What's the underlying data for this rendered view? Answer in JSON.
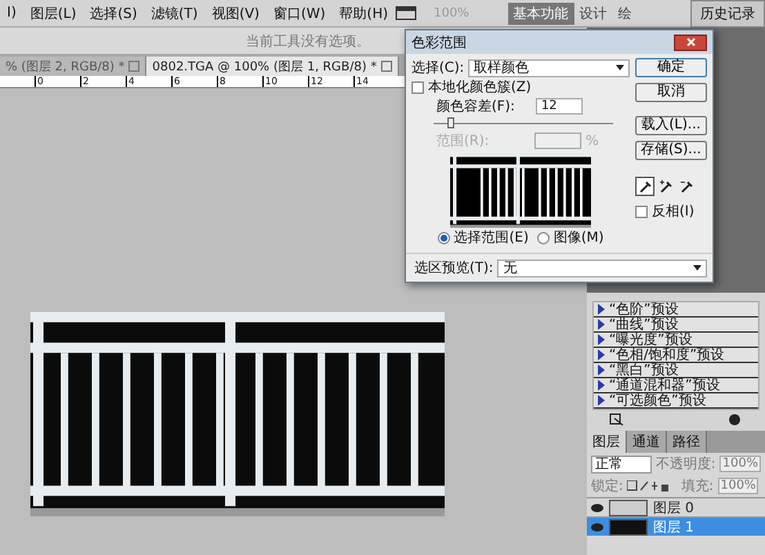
{
  "menu_bar": {
    "items": [
      {
        "label": "I)"
      },
      {
        "label": "图层(L)"
      },
      {
        "label": "选择(S)"
      },
      {
        "label": "滤镜(T)"
      },
      {
        "label": "视图(V)"
      },
      {
        "label": "窗口(W)"
      },
      {
        "label": "帮助(H)"
      }
    ],
    "zoom": "100%"
  },
  "workspaces": [
    {
      "label": "基本功能",
      "selected": true
    },
    {
      "label": "设计",
      "selected": false
    },
    {
      "label": "绘",
      "selected": false
    }
  ],
  "history_panel": {
    "title": "历史记录"
  },
  "options_bar": {
    "hint": "当前工具没有选项。"
  },
  "document_tabs": [
    {
      "label": "% (图层 2, RGB/8) *",
      "selected": false
    },
    {
      "label": "0802.TGA @ 100% (图层 1, RGB/8) *",
      "selected": true
    }
  ],
  "ruler": {
    "ticks": [
      "0",
      "2",
      "4",
      "6",
      "8",
      "10",
      "12",
      "14"
    ]
  },
  "dialog": {
    "title": "色彩范围",
    "select_label": "选择(C):",
    "select_value": "取样颜色",
    "localized": {
      "label": "本地化颜色簇(Z)",
      "checked": false
    },
    "tolerance": {
      "label": "颜色容差(F):",
      "value": "12",
      "level": 0.08
    },
    "range": {
      "label": "范围(R):",
      "unit": "%",
      "disabled": true
    },
    "preview_modes": [
      {
        "label": "选择范围(E)",
        "selected": true
      },
      {
        "label": "图像(M)",
        "selected": false
      }
    ],
    "selection_preview": {
      "label": "选区预览(T):",
      "value": "无"
    },
    "buttons": [
      {
        "label": "确定",
        "kind": "default"
      },
      {
        "label": "取消",
        "kind": "normal"
      },
      {
        "label": "载入(L)...",
        "kind": "normal"
      },
      {
        "label": "存储(S)...",
        "kind": "normal"
      }
    ],
    "eyedroppers": [
      {
        "kind": "sample",
        "selected": true
      },
      {
        "kind": "add",
        "selected": false
      },
      {
        "kind": "subtract",
        "selected": false
      }
    ],
    "invert": {
      "label": "反相(I)",
      "checked": false
    }
  },
  "adjustments": {
    "presets": [
      "“色阶”预设",
      "“曲线”预设",
      "“曝光度”预设",
      "“色相/饱和度”预设",
      "“黑白”预设",
      "“通道混和器”预设",
      "“可选颜色”预设"
    ]
  },
  "layers_panel": {
    "tabs": [
      {
        "label": "图层",
        "selected": true
      },
      {
        "label": "通道",
        "selected": false
      },
      {
        "label": "路径",
        "selected": false
      }
    ],
    "blend_mode": "正常",
    "opacity_label": "不透明度:",
    "opacity": "100%",
    "lock_label": "锁定:",
    "fill_label": "填充:",
    "fill": "100%",
    "layers": [
      {
        "name": "图层 0",
        "selected": false,
        "visible": true
      },
      {
        "name": "图层 1",
        "selected": true,
        "visible": true
      }
    ]
  }
}
